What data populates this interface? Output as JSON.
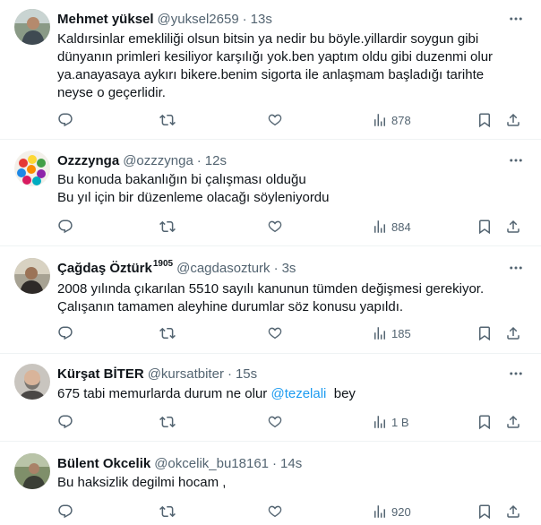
{
  "tweets": [
    {
      "name": "Mehmet yüksel",
      "badge": "",
      "handle": "@yuksel2659",
      "time": "13s",
      "lines": [
        "Kaldırsinlar emekliliği olsun bitsin ya nedir bu böyle.yillardir soygun gibi",
        "dünyanın primleri kesiliyor karşılığı yok.ben yaptım oldu gibi duzenmi olur",
        "ya.anayasaya aykırı bikere.benim sigorta ile anlaşmam başladığı tarihte",
        "neyse o geçerlidir."
      ],
      "views": "878"
    },
    {
      "name": "Ozzzynga",
      "badge": "",
      "handle": "@ozzzynga",
      "time": "12s",
      "lines": [
        "Bu konuda bakanlığın bi çalışması olduğu",
        "Bu yıl için bir düzenleme olacağı söyleniyordu"
      ],
      "views": "884"
    },
    {
      "name": "Çağdaş Öztürk",
      "badge": "1905",
      "handle": "@cagdasozturk",
      "time": "3s",
      "lines": [
        "2008 yılında çıkarılan 5510 sayılı kanunun tümden değişmesi gerekiyor.",
        "Çalışanın tamamen aleyhine durumlar söz konusu yapıldı."
      ],
      "views": "185"
    },
    {
      "name": "Kürşat BİTER",
      "badge": "",
      "handle": "@kursatbiter",
      "time": "15s",
      "text_before": "675 tabi memurlarda durum ne olur ",
      "mention": "@tezelali",
      "text_after": "  bey",
      "views": "1 B"
    },
    {
      "name": "Bülent Okcelik",
      "badge": "",
      "handle": "@okcelik_bu18161",
      "time": "14s",
      "lines": [
        "Bu haksizlik degilmi hocam ,"
      ],
      "views": "920"
    }
  ],
  "separator": "·",
  "icons": {
    "more": "more-icon",
    "reply": "reply-icon",
    "retweet": "retweet-icon",
    "like": "like-icon",
    "views": "views-icon",
    "bookmark": "bookmark-icon",
    "share": "share-icon"
  },
  "colors": {
    "text": "#0f1419",
    "secondary": "#536471",
    "link": "#1d9bf0",
    "divider": "#eff3f4"
  }
}
